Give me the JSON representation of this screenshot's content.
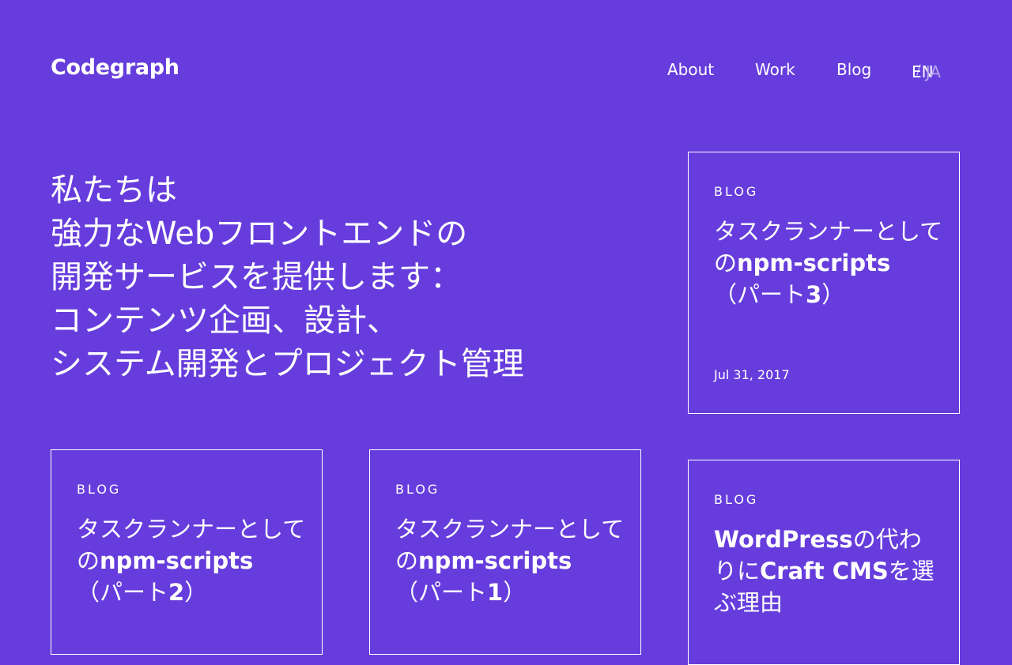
{
  "header": {
    "logo": "Codegraph",
    "nav": [
      "About",
      "Work",
      "Blog"
    ],
    "lang": {
      "en": "EN",
      "separator": "/",
      "ja": "JA"
    }
  },
  "hero": {
    "lines": [
      "私たちは",
      "強力なWebフロントエンドの",
      "開発サービスを提供します：",
      "コンテンツ企画、設計、",
      "システム開発とプロジェクト管理"
    ]
  },
  "cards": [
    {
      "category": "BLOG",
      "title": [
        "タスクランナーとしての",
        "npm-scripts",
        "（パート",
        "3",
        "）"
      ],
      "date": "Jul 31, 2017"
    },
    {
      "category": "BLOG",
      "title": [
        "タスクランナーとしての",
        "npm-scripts",
        "（パート",
        "2",
        "）"
      ]
    },
    {
      "category": "BLOG",
      "title": [
        "タスクランナーとしての",
        "npm-scripts",
        "（パート",
        "1",
        "）"
      ]
    },
    {
      "category": "BLOG",
      "title": [
        "",
        "WordPress",
        "の代わりに",
        "Craft CMS",
        "を選ぶ理由"
      ]
    }
  ],
  "colors": {
    "background": "#663ddc",
    "text": "#ffffff",
    "muted": "#b8a7ef"
  }
}
